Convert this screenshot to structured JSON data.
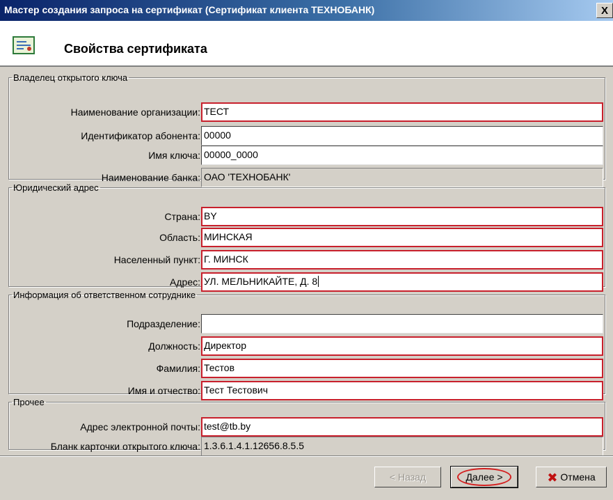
{
  "window": {
    "title": "Мастер создания запроса на сертификат (Сертификат клиента ТЕХНОБАНК)",
    "close_label": "X"
  },
  "header": {
    "title": "Свойства сертификата",
    "icon": "certificate-icon"
  },
  "groups": {
    "owner": {
      "legend": "Владелец открытого ключа",
      "org_name": {
        "label": "Наименование организации:",
        "value": "ТЕСТ"
      },
      "subscriber_id": {
        "label": "Идентификатор абонента:",
        "value": "00000"
      },
      "key_name": {
        "label": "Имя ключа:",
        "value": "00000_0000"
      },
      "bank_name": {
        "label": "Наименование банка:",
        "value": "ОАО 'ТЕХНОБАНК'"
      }
    },
    "address": {
      "legend": "Юридический адрес",
      "country": {
        "label": "Страна:",
        "value": "BY"
      },
      "region": {
        "label": "Область:",
        "value": "МИНСКАЯ"
      },
      "locality": {
        "label": "Населенный пункт:",
        "value": "Г. МИНСК"
      },
      "street": {
        "label": "Адрес:",
        "value": "УЛ. МЕЛЬНИКАЙТЕ, Д. 8"
      }
    },
    "employee": {
      "legend": "Информация об ответственном сотруднике",
      "department": {
        "label": "Подразделение:",
        "value": ""
      },
      "position": {
        "label": "Должность:",
        "value": "Директор"
      },
      "surname": {
        "label": "Фамилия:",
        "value": "Тестов"
      },
      "name_patronymic": {
        "label": "Имя и отчество:",
        "value": "Тест Тестович"
      }
    },
    "other": {
      "legend": "Прочее",
      "email": {
        "label": "Адрес электронной почты:",
        "value": "test@tb.by"
      },
      "key_card_form": {
        "label": "Бланк карточки открытого ключа:",
        "value": "1.3.6.1.4.1.12656.8.5.5"
      }
    }
  },
  "buttons": {
    "back": "< Назад",
    "next": "Далее >",
    "cancel": "Отмена"
  },
  "colors": {
    "required_border": "#c8202c",
    "titlebar_start": "#0a246a",
    "window_bg": "#d4d0c8"
  }
}
